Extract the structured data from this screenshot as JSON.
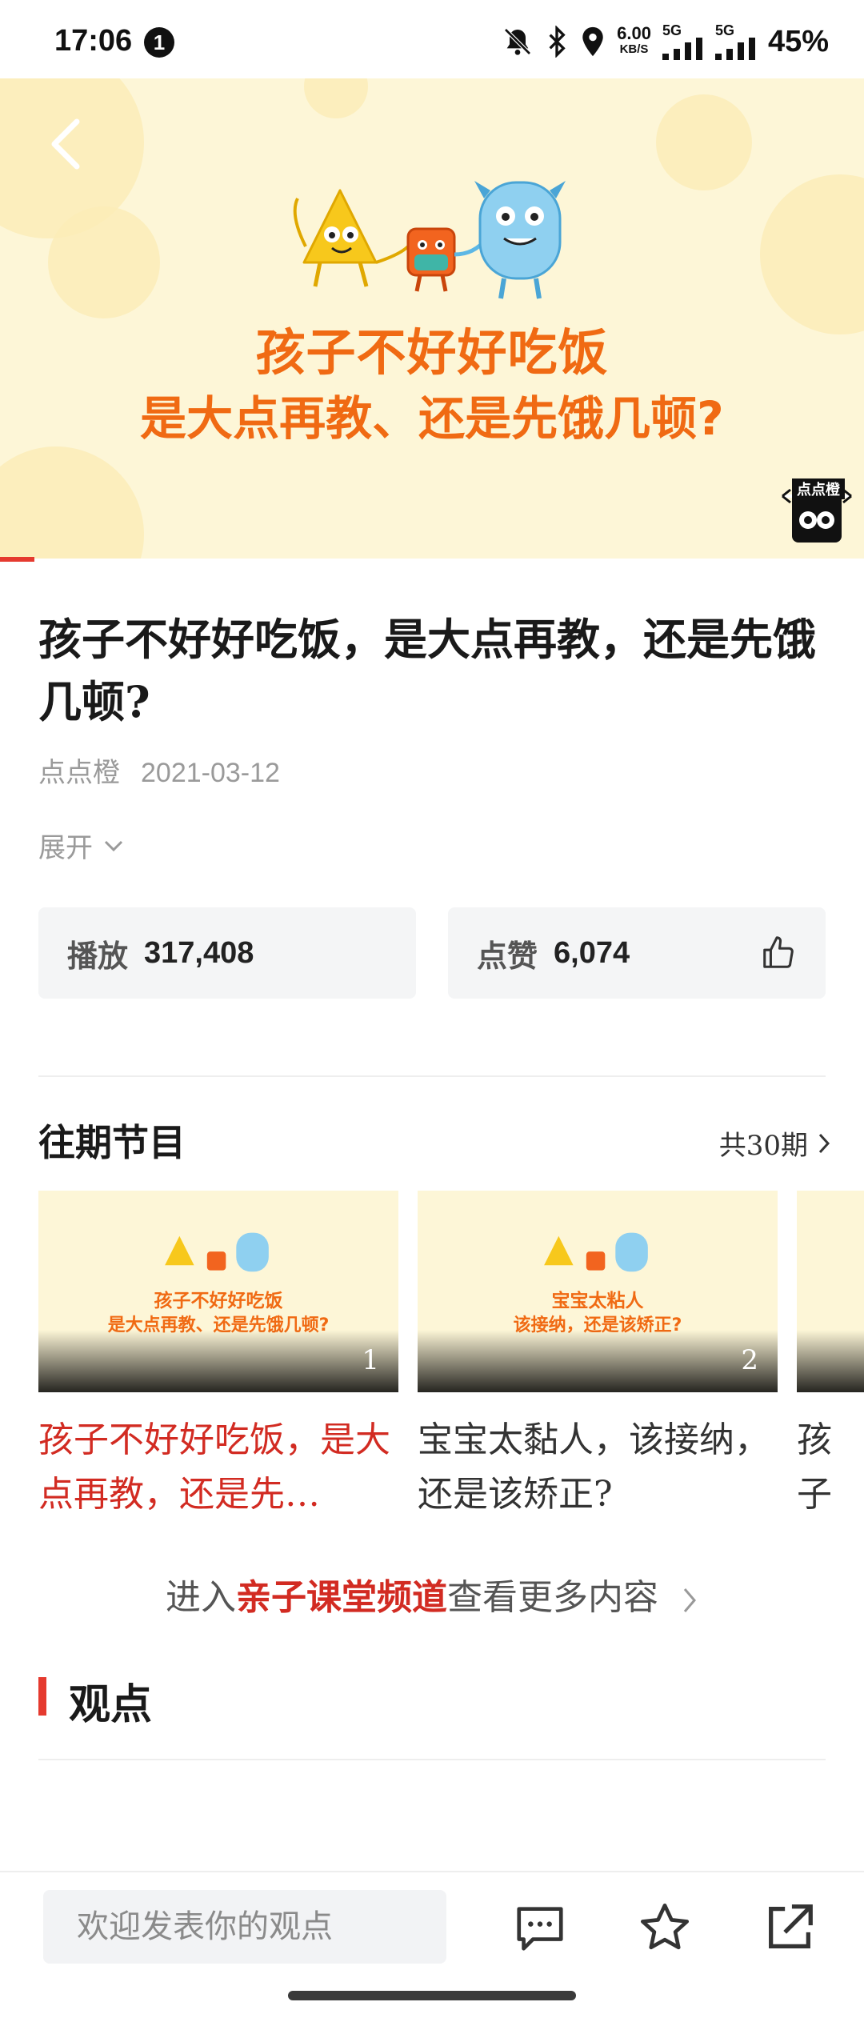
{
  "status_bar": {
    "time": "17:06",
    "notification_count": "1",
    "net_speed_value": "6.00",
    "net_speed_unit": "KB/S",
    "signal_label_1": "5G",
    "signal_label_2": "5G",
    "battery": "45%"
  },
  "video": {
    "title_line1": "孩子不好好吃饭",
    "title_line2": "是大点再教、还是先饿几顿?",
    "logo_text": "点点橙",
    "progress_fraction": 0.04
  },
  "article": {
    "title": "孩子不好好吃饭，是大点再教，还是先饿几顿?",
    "author": "点点橙",
    "date": "2021-03-12",
    "expand_label": "展开"
  },
  "stats": {
    "play_label": "播放",
    "play_value": "317,408",
    "like_label": "点赞",
    "like_value": "6,074"
  },
  "past_episodes": {
    "heading": "往期节目",
    "total_label": "共30期",
    "items": [
      {
        "thumb_line1": "孩子不好好吃饭",
        "thumb_line2": "是大点再教、还是先饿几顿?",
        "number": "1",
        "caption": "孩子不好好吃饭，是大点再教，还是先…"
      },
      {
        "thumb_line1": "宝宝太粘人",
        "thumb_line2": "该接纳，还是该矫正?",
        "number": "2",
        "caption": "宝宝太黏人，该接纳，还是该矫正?"
      },
      {
        "thumb_line1": "",
        "thumb_line2": "",
        "number": "",
        "caption": "孩子随他"
      }
    ]
  },
  "channel_link": {
    "prefix": "进入",
    "highlight": "亲子课堂频道",
    "suffix": "查看更多内容"
  },
  "opinion": {
    "heading": "观点"
  },
  "bottom_bar": {
    "comment_placeholder": "欢迎发表你的观点",
    "icons": [
      "comment-icon",
      "star-icon",
      "share-icon"
    ]
  },
  "colors": {
    "accent_red": "#d22b22",
    "banner_bg": "#fdf6d7",
    "banner_text": "#f06a13"
  }
}
